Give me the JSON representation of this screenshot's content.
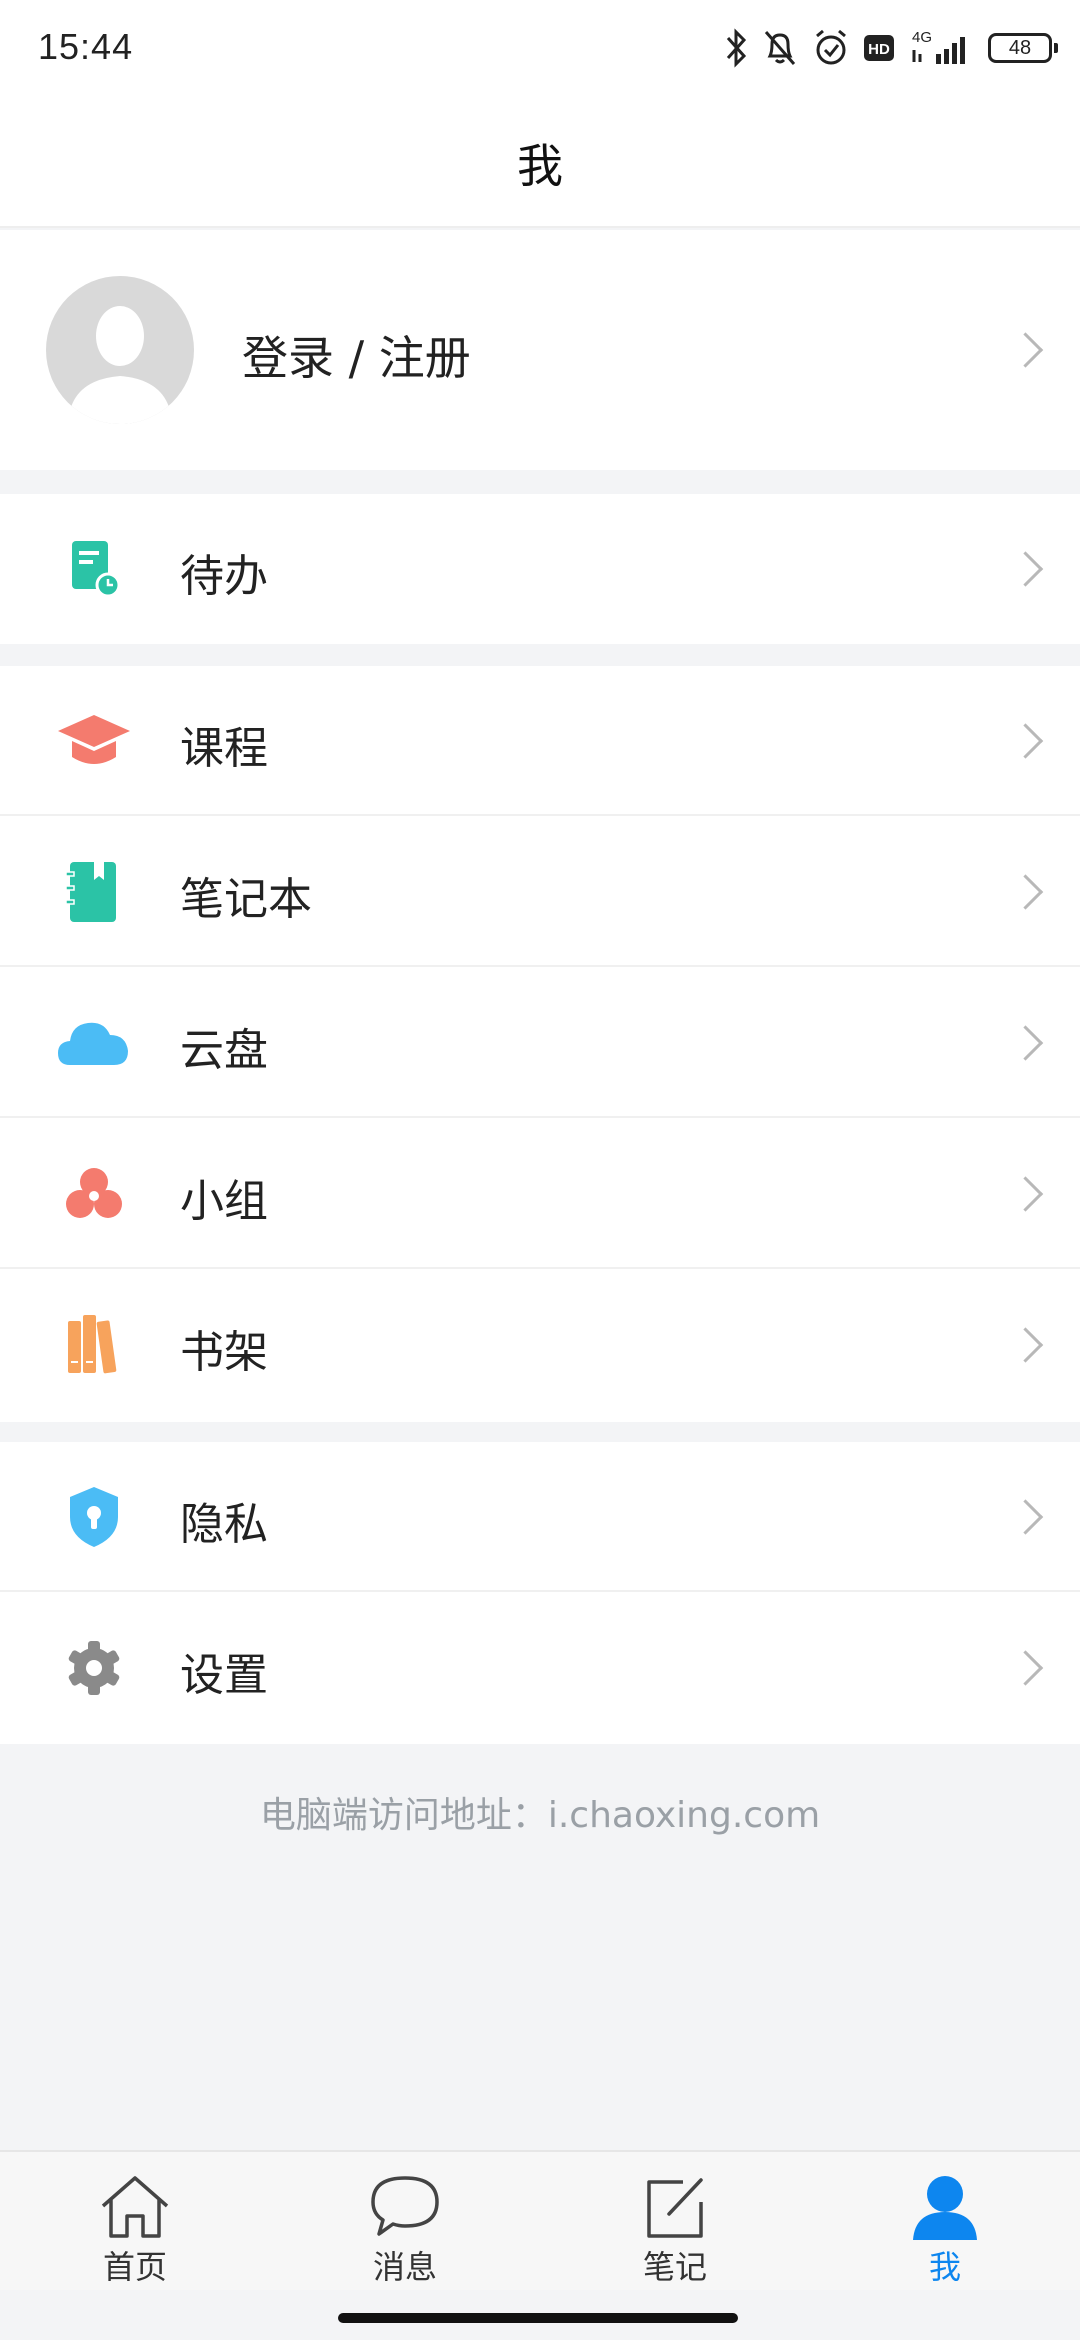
{
  "status_bar": {
    "time": "15:44",
    "network": "4G",
    "battery": "48"
  },
  "header": {
    "title": "我"
  },
  "profile": {
    "login_label": "登录 / 注册"
  },
  "menu_groups": [
    [
      {
        "label": "待办",
        "icon": "todo-icon",
        "color": "#2bc3a6"
      }
    ],
    [
      {
        "label": "课程",
        "icon": "graduation-cap-icon",
        "color": "#f47b6e"
      },
      {
        "label": "笔记本",
        "icon": "notebook-icon",
        "color": "#2bc3a6"
      },
      {
        "label": "云盘",
        "icon": "cloud-icon",
        "color": "#4bbcf5"
      },
      {
        "label": "小组",
        "icon": "group-icon",
        "color": "#f47b6e"
      },
      {
        "label": "书架",
        "icon": "bookshelf-icon",
        "color": "#f7a35c"
      }
    ],
    [
      {
        "label": "隐私",
        "icon": "privacy-shield-icon",
        "color": "#4bbcf5"
      },
      {
        "label": "设置",
        "icon": "gear-icon",
        "color": "#8a8a8a"
      }
    ]
  ],
  "footer_note": "电脑端访问地址：i.chaoxing.com",
  "tab_bar": {
    "tabs": [
      {
        "label": "首页",
        "icon": "home-icon"
      },
      {
        "label": "消息",
        "icon": "message-icon"
      },
      {
        "label": "笔记",
        "icon": "note-edit-icon"
      },
      {
        "label": "我",
        "icon": "person-icon"
      }
    ],
    "active_color": "#0d86ef"
  }
}
